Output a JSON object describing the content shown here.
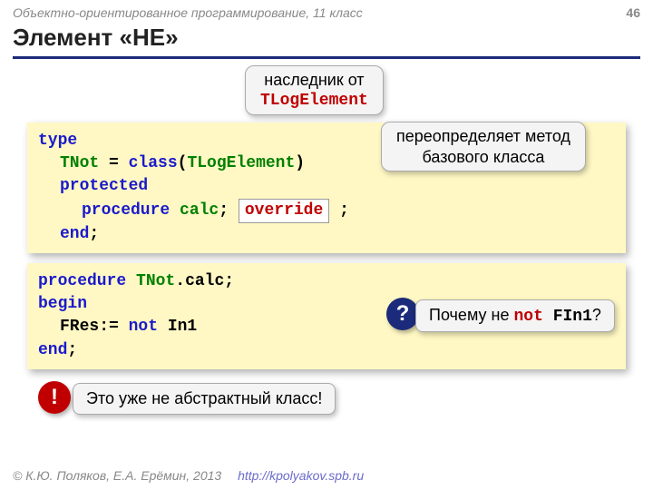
{
  "meta": {
    "course": "Объектно-ориентированное программирование, 11 класс",
    "page": "46",
    "title": "Элемент «НЕ»",
    "copyright": "© К.Ю. Поляков, Е.А. Ерёмин, 2013",
    "url": "http://kpolyakov.spb.ru"
  },
  "callout_inherit_line1": "наследник от",
  "callout_inherit_line2": "TLogElement",
  "callout_override_line1": "переопределяет метод",
  "callout_override_line2": "базового класса",
  "code": {
    "type": "type",
    "tnot": "TNot",
    "eq": " = ",
    "class_kw": "class",
    "paren_open": "(",
    "base": "TLogElement",
    "paren_close": ")",
    "protected": "protected",
    "procedure_kw": "procedure",
    "calc": "calc",
    "semi": "; ",
    "override": "override",
    "semi2": " ;",
    "end": "end",
    "end_semi": ";"
  },
  "code2": {
    "procedure": "procedure",
    "tnot": "TNot",
    "dot": ".",
    "calc": "calc",
    "semi": ";",
    "begin": "begin",
    "line": "FRes:= ",
    "not": "not",
    "in1": " In1",
    "end": "end",
    "end_semi": ";"
  },
  "question_badge": "?",
  "question_pre": "Почему не ",
  "question_code": "not",
  "question_post": " FIn1",
  "question_q": "?",
  "exclaim_badge": "!",
  "exclaim_text": "Это уже не абстрактный класс!"
}
